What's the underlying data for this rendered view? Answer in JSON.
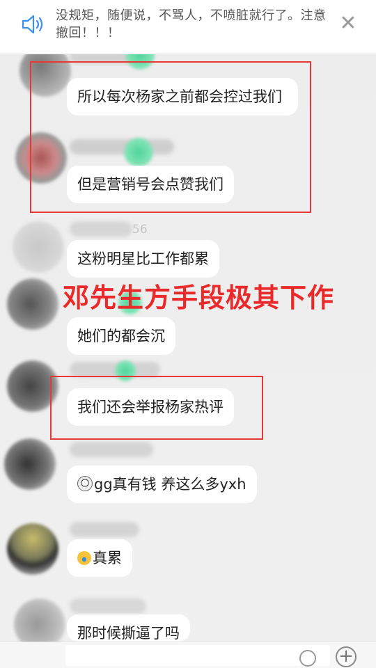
{
  "announcement": {
    "text": "没规矩，随便说，不骂人，不喷脏就行了。注意撤回！！！",
    "close_icon": "close-icon",
    "speaker_icon": "speaker-icon"
  },
  "messages": [
    {
      "text": "所以每次杨家之前都会控过我们"
    },
    {
      "text": "但是营销号会点赞我们"
    },
    {
      "text": "这粉明星比工作都累"
    },
    {
      "text": "她们的都会沉"
    },
    {
      "text": "我们还会举报杨家热评"
    },
    {
      "emoji": "crying-face-icon",
      "text": "gg真有钱 养这么多yxh"
    },
    {
      "emoji": "laughing-face-icon",
      "text": "真累"
    },
    {
      "text": "那时候撕逼了吗"
    }
  ],
  "overlay_caption": "邓先生方手段极其下作",
  "faint_fragment": "56",
  "input_bar": {
    "emoji_icon": "smiley-icon",
    "plus_icon": "plus-icon"
  },
  "colors": {
    "highlight": "#e53935",
    "caption": "#ea2a2a",
    "bubble": "#ffffff"
  }
}
